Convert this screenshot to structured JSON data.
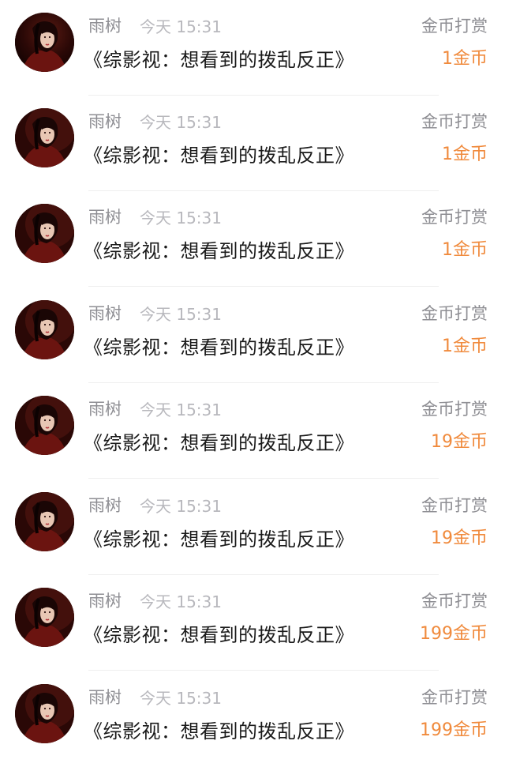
{
  "records": [
    {
      "user": "雨树",
      "time": "今天 15:31",
      "book": "《综影视：想看到的拨乱反正》",
      "type": "金币打赏",
      "amount": "1金币"
    },
    {
      "user": "雨树",
      "time": "今天 15:31",
      "book": "《综影视：想看到的拨乱反正》",
      "type": "金币打赏",
      "amount": "1金币"
    },
    {
      "user": "雨树",
      "time": "今天 15:31",
      "book": "《综影视：想看到的拨乱反正》",
      "type": "金币打赏",
      "amount": "1金币"
    },
    {
      "user": "雨树",
      "time": "今天 15:31",
      "book": "《综影视：想看到的拨乱反正》",
      "type": "金币打赏",
      "amount": "1金币"
    },
    {
      "user": "雨树",
      "time": "今天 15:31",
      "book": "《综影视：想看到的拨乱反正》",
      "type": "金币打赏",
      "amount": "19金币"
    },
    {
      "user": "雨树",
      "time": "今天 15:31",
      "book": "《综影视：想看到的拨乱反正》",
      "type": "金币打赏",
      "amount": "19金币"
    },
    {
      "user": "雨树",
      "time": "今天 15:31",
      "book": "《综影视：想看到的拨乱反正》",
      "type": "金币打赏",
      "amount": "199金币"
    },
    {
      "user": "雨树",
      "time": "今天 15:31",
      "book": "《综影视：想看到的拨乱反正》",
      "type": "金币打赏",
      "amount": "199金币"
    }
  ],
  "colors": {
    "accent": "#f08a3c",
    "muted": "#8e8e93",
    "light": "#b8b8bd",
    "text": "#1a1a1a"
  }
}
